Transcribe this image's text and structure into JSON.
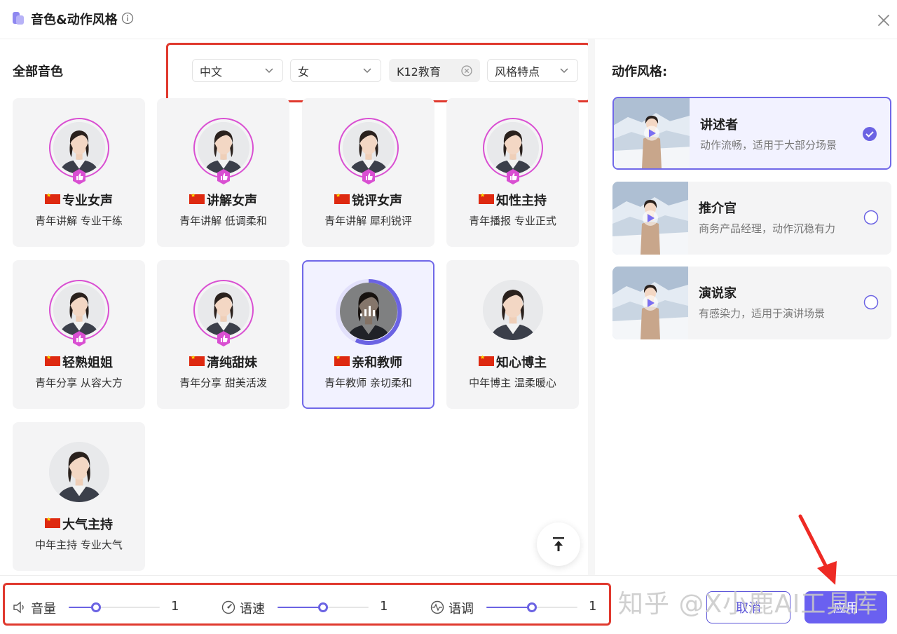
{
  "header": {
    "title": "音色&动作风格",
    "logo_icon": "voice-logo-icon",
    "info_icon": "info-icon",
    "close_icon": "close-icon"
  },
  "voices_section": {
    "title": "全部音色",
    "filters": [
      {
        "label": "中文",
        "type": "dropdown"
      },
      {
        "label": "女",
        "type": "dropdown"
      },
      {
        "label": "K12教育",
        "type": "tag"
      },
      {
        "label": "风格特点",
        "type": "dropdown"
      }
    ],
    "cards": [
      {
        "name": "专业女声",
        "desc": "青年讲解 专业干练"
      },
      {
        "name": "讲解女声",
        "desc": "青年讲解 低调柔和"
      },
      {
        "name": "锐评女声",
        "desc": "青年讲解 犀利锐评"
      },
      {
        "name": "知性主持",
        "desc": "青年播报 专业正式"
      },
      {
        "name": "轻熟姐姐",
        "desc": "青年分享 从容大方"
      },
      {
        "name": "清纯甜妹",
        "desc": "青年分享 甜美活泼"
      },
      {
        "name": "亲和教师",
        "desc": "青年教师 亲切柔和"
      },
      {
        "name": "知心博主",
        "desc": "中年博主 温柔暖心"
      },
      {
        "name": "大气主持",
        "desc": "中年主持 专业大气"
      }
    ]
  },
  "motion_section": {
    "title": "动作风格:",
    "items": [
      {
        "name": "讲述者",
        "desc": "动作流畅，适用于大部分场景"
      },
      {
        "name": "推介官",
        "desc": "商务产品经理，动作沉稳有力"
      },
      {
        "name": "演说家",
        "desc": "有感染力，适用于演讲场景"
      }
    ]
  },
  "controls": {
    "volume": {
      "label": "音量",
      "value": "1",
      "icon": "speaker-icon",
      "level": 0.3
    },
    "speed": {
      "label": "语速",
      "value": "1",
      "icon": "speed-icon",
      "level": 0.5
    },
    "pitch": {
      "label": "语调",
      "value": "1",
      "icon": "pitch-icon",
      "level": 0.5
    }
  },
  "buttons": {
    "cancel": "取消",
    "apply": "应用"
  },
  "watermark": "知乎 @X小鹿AI工具库",
  "colors": {
    "accent": "#6a60f0",
    "highlight_red": "#e0392e",
    "ring_pink": "#d94fd2",
    "flag_red": "#de2910"
  }
}
